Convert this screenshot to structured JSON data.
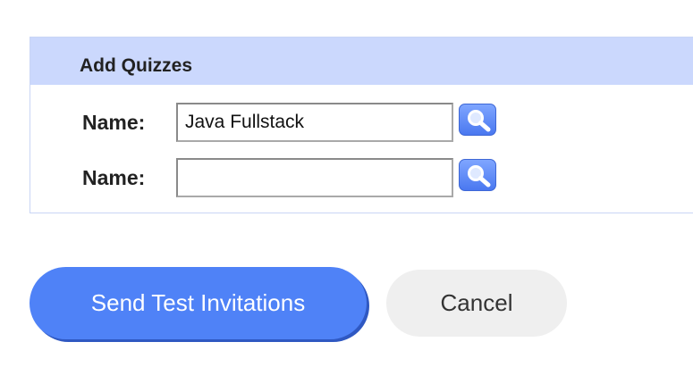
{
  "panel": {
    "title": "Add Quizzes",
    "header_color": "#cbd8fd",
    "rows": [
      {
        "label": "Name:",
        "value": "Java Fullstack",
        "search_icon": "search-icon"
      },
      {
        "label": "Name:",
        "value": "",
        "search_icon": "search-icon"
      }
    ]
  },
  "actions": {
    "send_label": "Send Test Invitations",
    "cancel_label": "Cancel",
    "primary_color": "#4f82f7"
  }
}
